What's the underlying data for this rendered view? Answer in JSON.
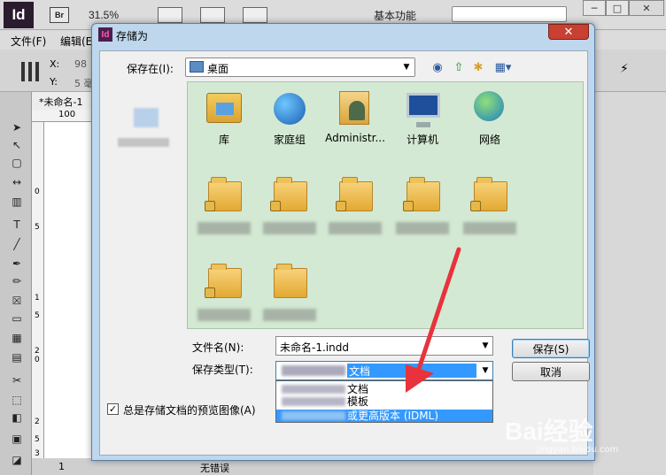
{
  "app": {
    "logo": "Id",
    "bridge": "Br",
    "zoom": "31.5%",
    "workspace": "基本功能",
    "menu": [
      "文件(F)",
      "编辑(E)"
    ],
    "ctrl": {
      "x_label": "X:",
      "y_label": "Y:",
      "x_value": "98",
      "y_value": "5 毫"
    },
    "doc_tab": "*未命名-1",
    "ruler_h": "100",
    "ruler_v": [
      "0",
      "5",
      "1",
      "5",
      "2",
      "0",
      "2",
      "5",
      "3"
    ],
    "page_number": "1",
    "status": "无错误",
    "window_buttons": [
      "─",
      "□",
      "✕"
    ]
  },
  "dialog": {
    "icon": "Id",
    "title": "存储为",
    "close": "✕",
    "save_in_label": "保存在(I):",
    "save_in_value": "桌面",
    "files": [
      {
        "label": "库",
        "icon": "library-icon"
      },
      {
        "label": "家庭组",
        "icon": "homegroup-icon"
      },
      {
        "label": "Administr...",
        "icon": "user-folder-icon"
      },
      {
        "label": "计算机",
        "icon": "computer-icon"
      },
      {
        "label": "网络",
        "icon": "network-icon"
      }
    ],
    "filename_label": "文件名(N):",
    "filename_value": "未命名-1.indd",
    "filetype_label": "保存类型(T):",
    "filetype_value": "文档",
    "filetype_options": [
      "文档",
      "模板",
      "或更高版本 (IDML)"
    ],
    "save_button": "保存(S)",
    "cancel_button": "取消",
    "preview_label": "总是存储文档的预览图像(A)",
    "preview_checked": "✓"
  },
  "watermark": {
    "brand": "Bai经验",
    "url": "jingyan.baidu.com"
  },
  "colors": {
    "accent": "#3399ff",
    "arrow": "#e8323c",
    "close": "#c84031"
  }
}
